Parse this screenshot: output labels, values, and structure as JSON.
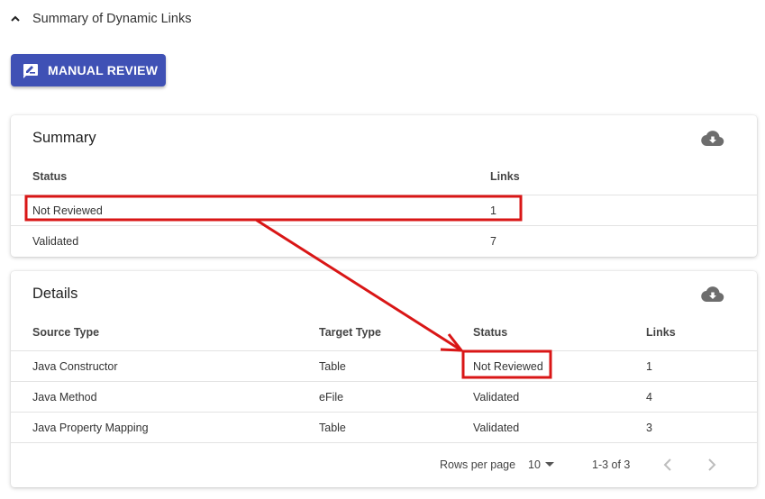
{
  "section": {
    "title": "Summary of Dynamic Links"
  },
  "toolbar": {
    "manual_review_label": "MANUAL REVIEW"
  },
  "summary": {
    "title": "Summary",
    "columns": [
      "Status",
      "Links"
    ],
    "rows": [
      [
        "Not Reviewed",
        "1"
      ],
      [
        "Validated",
        "7"
      ]
    ]
  },
  "details": {
    "title": "Details",
    "columns": [
      "Source Type",
      "Target Type",
      "Status",
      "Links"
    ],
    "rows": [
      [
        "Java Constructor",
        "Table",
        "Not Reviewed",
        "1"
      ],
      [
        "Java Method",
        "eFile",
        "Validated",
        "4"
      ],
      [
        "Java Property Mapping",
        "Table",
        "Validated",
        "3"
      ]
    ],
    "footer": {
      "rows_per_page_label": "Rows per page",
      "rows_per_page_value": "10",
      "range": "1-3 of 3"
    }
  },
  "icons": {
    "collapse": "chevron-up-icon",
    "manual_review": "rate-review-icon",
    "download": "cloud-download-icon",
    "prev": "chevron-left-icon",
    "next": "chevron-right-icon",
    "dropdown": "arrow-drop-down-icon"
  },
  "colors": {
    "primary": "#3f51b5",
    "annotation": "#d91616"
  }
}
